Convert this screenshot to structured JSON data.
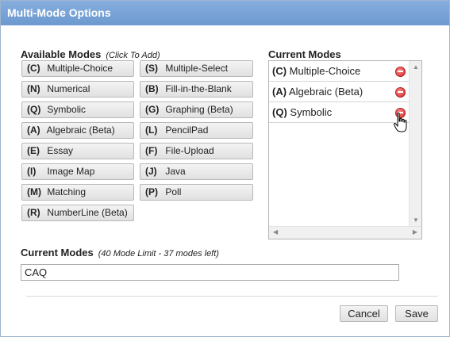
{
  "dialog": {
    "title": "Multi-Mode Options"
  },
  "available": {
    "heading": "Available Modes",
    "note": "(Click To Add)",
    "left_column": [
      {
        "code": "(C)",
        "label": "Multiple-Choice"
      },
      {
        "code": "(N)",
        "label": "Numerical"
      },
      {
        "code": "(Q)",
        "label": "Symbolic"
      },
      {
        "code": "(A)",
        "label": "Algebraic (Beta)"
      },
      {
        "code": "(E)",
        "label": "Essay"
      },
      {
        "code": "(I)",
        "label": "Image Map"
      },
      {
        "code": "(M)",
        "label": "Matching"
      },
      {
        "code": "(R)",
        "label": "NumberLine (Beta)"
      }
    ],
    "right_column": [
      {
        "code": "(S)",
        "label": "Multiple-Select"
      },
      {
        "code": "(B)",
        "label": "Fill-in-the-Blank"
      },
      {
        "code": "(G)",
        "label": "Graphing (Beta)"
      },
      {
        "code": "(L)",
        "label": "PencilPad"
      },
      {
        "code": "(F)",
        "label": "File-Upload"
      },
      {
        "code": "(J)",
        "label": "Java"
      },
      {
        "code": "(P)",
        "label": "Poll"
      }
    ]
  },
  "current_list": {
    "heading": "Current Modes",
    "items": [
      {
        "code": "(C)",
        "label": "Multiple-Choice"
      },
      {
        "code": "(A)",
        "label": "Algebraic (Beta)"
      },
      {
        "code": "(Q)",
        "label": "Symbolic"
      }
    ]
  },
  "current_field": {
    "heading": "Current Modes",
    "note": "(40 Mode Limit - 37 modes left)",
    "value": "CAQ"
  },
  "buttons": {
    "cancel": "Cancel",
    "save": "Save"
  },
  "icons": {
    "remove": "remove-circle-icon",
    "cursor": "hand-pointer-icon"
  },
  "colors": {
    "title_bar": "#7aa4d8",
    "remove": "#d42a2a"
  }
}
